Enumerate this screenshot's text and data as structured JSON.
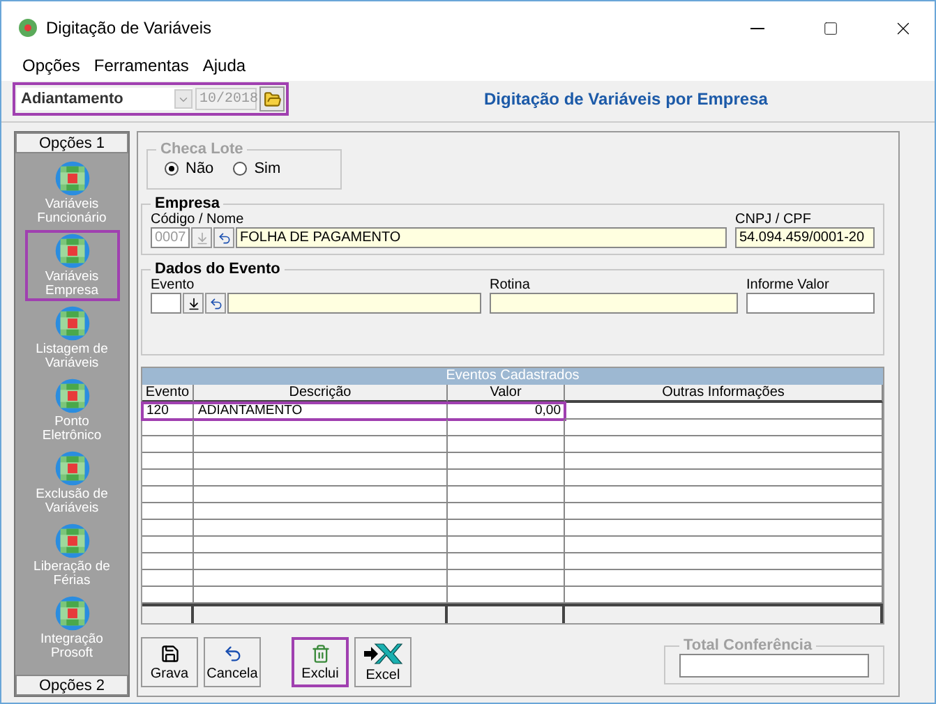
{
  "window": {
    "title": "Digitação de Variáveis"
  },
  "menu": [
    {
      "label": "Opções"
    },
    {
      "label": "Ferramentas"
    },
    {
      "label": "Ajuda"
    }
  ],
  "toolbar": {
    "type_select": "Adiantamento",
    "period": "10/2018",
    "highlighted": true
  },
  "form_title": "Digitação de Variáveis por Empresa",
  "sidebar": {
    "header": "Opções 1",
    "footer": "Opções 2",
    "items": [
      {
        "label": "Variáveis Funcionário",
        "selected": false
      },
      {
        "label": "Variáveis Empresa",
        "selected": true
      },
      {
        "label": "Listagem de Variáveis",
        "selected": false
      },
      {
        "label": "Ponto Eletrônico",
        "selected": false
      },
      {
        "label": "Exclusão de Variáveis",
        "selected": false
      },
      {
        "label": "Liberação de Férias",
        "selected": false
      },
      {
        "label": "Integração Prosoft",
        "selected": false
      }
    ]
  },
  "checa_lote": {
    "title": "Checa Lote",
    "disabled": true,
    "options": [
      {
        "label": "Não",
        "selected": true
      },
      {
        "label": "Sim",
        "selected": false
      }
    ]
  },
  "empresa": {
    "title": "Empresa",
    "code_label": "Código / Nome",
    "code": "0007",
    "name": "FOLHA DE PAGAMENTO",
    "cnpj_label": "CNPJ / CPF",
    "cnpj": "54.094.459/0001-20"
  },
  "evento": {
    "title": "Dados do Evento",
    "evento_label": "Evento",
    "rotina_label": "Rotina",
    "valor_label": "Informe Valor"
  },
  "table": {
    "title": "Eventos Cadastrados",
    "columns": [
      "Evento",
      "Descrição",
      "Valor",
      "Outras Informações"
    ],
    "rows": [
      {
        "evento": "120",
        "descricao": "ADIANTAMENTO",
        "valor": "0,00",
        "selected": true
      }
    ]
  },
  "buttons": [
    {
      "label": "Grava",
      "kind": "save",
      "highlighted": false
    },
    {
      "label": "Cancela",
      "kind": "undo",
      "highlighted": false
    },
    {
      "label": "Exclui",
      "kind": "delete",
      "highlighted": true
    },
    {
      "label": "Excel",
      "kind": "excel",
      "highlighted": false
    }
  ],
  "total": {
    "title": "Total Conferência",
    "disabled": true
  }
}
